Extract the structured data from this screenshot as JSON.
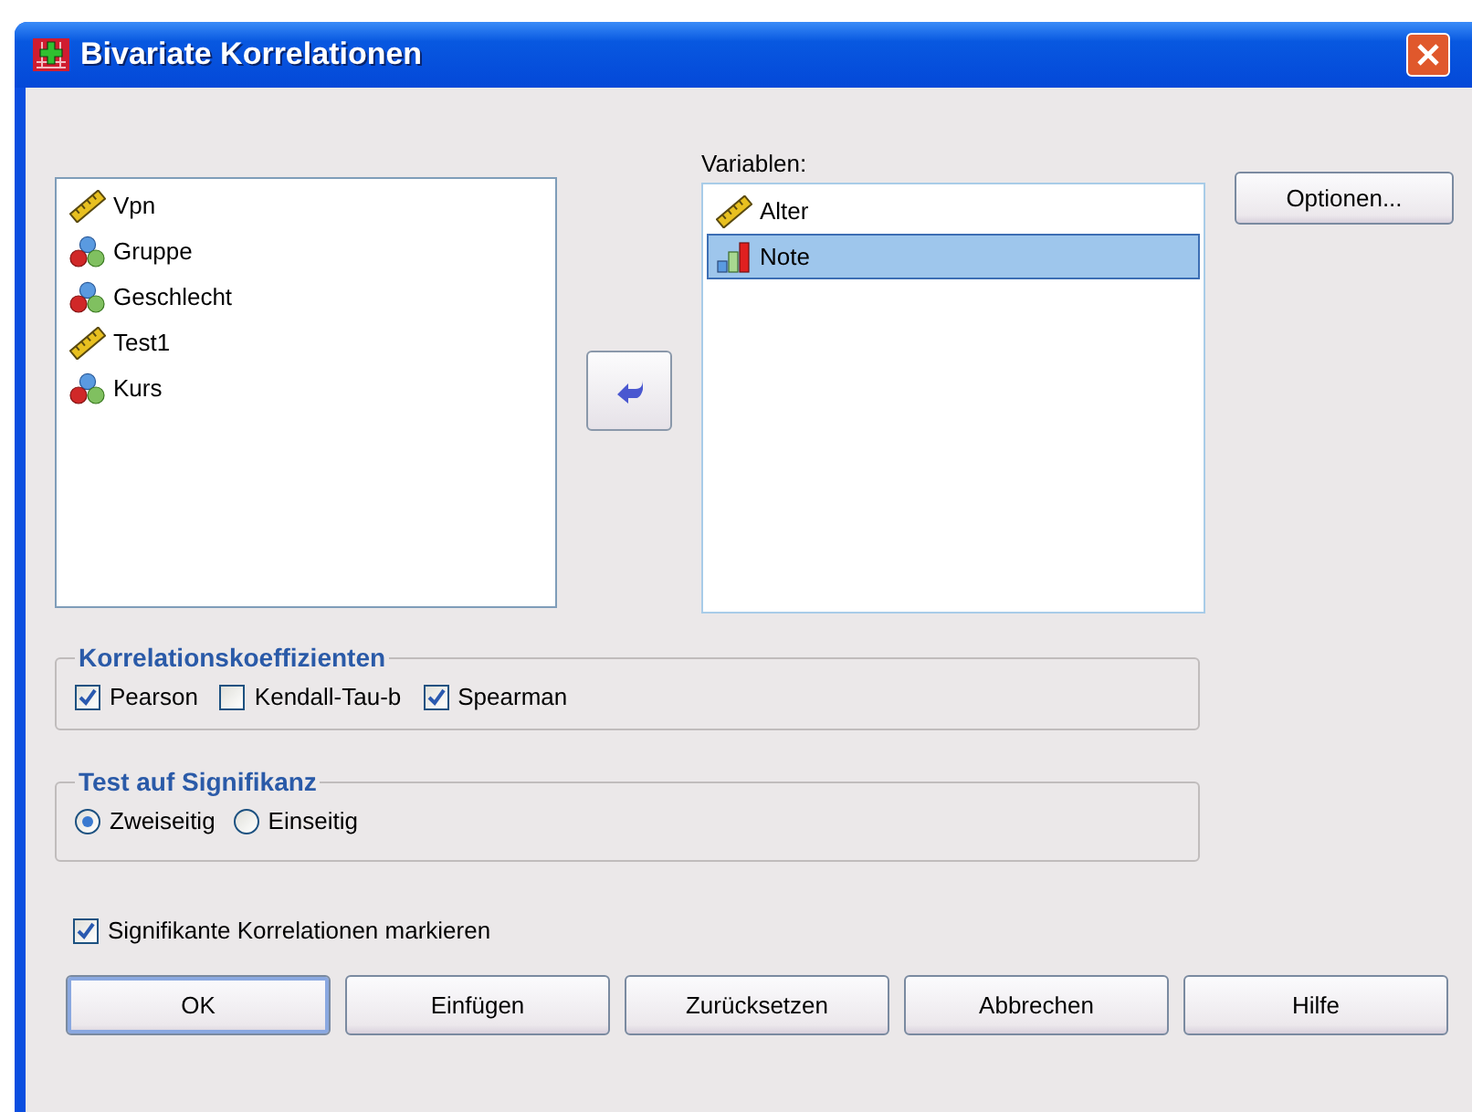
{
  "window": {
    "title": "Bivariate Korrelationen"
  },
  "source_list": {
    "items": [
      {
        "label": "Vpn",
        "kind": "scale",
        "selected": false
      },
      {
        "label": "Gruppe",
        "kind": "nominal",
        "selected": false
      },
      {
        "label": "Geschlecht",
        "kind": "nominal",
        "selected": false
      },
      {
        "label": "Test1",
        "kind": "scale",
        "selected": false
      },
      {
        "label": "Kurs",
        "kind": "nominal",
        "selected": false
      }
    ]
  },
  "target_list": {
    "label": "Variablen:",
    "items": [
      {
        "label": "Alter",
        "kind": "scale",
        "selected": false
      },
      {
        "label": "Note",
        "kind": "ordinal",
        "selected": true
      }
    ]
  },
  "options_button": "Optionen...",
  "coefficients": {
    "title": "Korrelationskoeffizienten",
    "options": [
      {
        "label": "Pearson",
        "checked": true
      },
      {
        "label": "Kendall-Tau-b",
        "checked": false
      },
      {
        "label": "Spearman",
        "checked": true
      }
    ]
  },
  "significance": {
    "title": "Test auf Signifikanz",
    "options": [
      {
        "label": "Zweiseitig",
        "selected": true
      },
      {
        "label": "Einseitig",
        "selected": false
      }
    ]
  },
  "flag_significant": {
    "label": "Signifikante Korrelationen markieren",
    "checked": true
  },
  "buttons": [
    {
      "label": "OK",
      "default": true
    },
    {
      "label": "Einfügen",
      "default": false
    },
    {
      "label": "Zurücksetzen",
      "default": false
    },
    {
      "label": "Abbrechen",
      "default": false
    },
    {
      "label": "Hilfe",
      "default": false
    }
  ]
}
